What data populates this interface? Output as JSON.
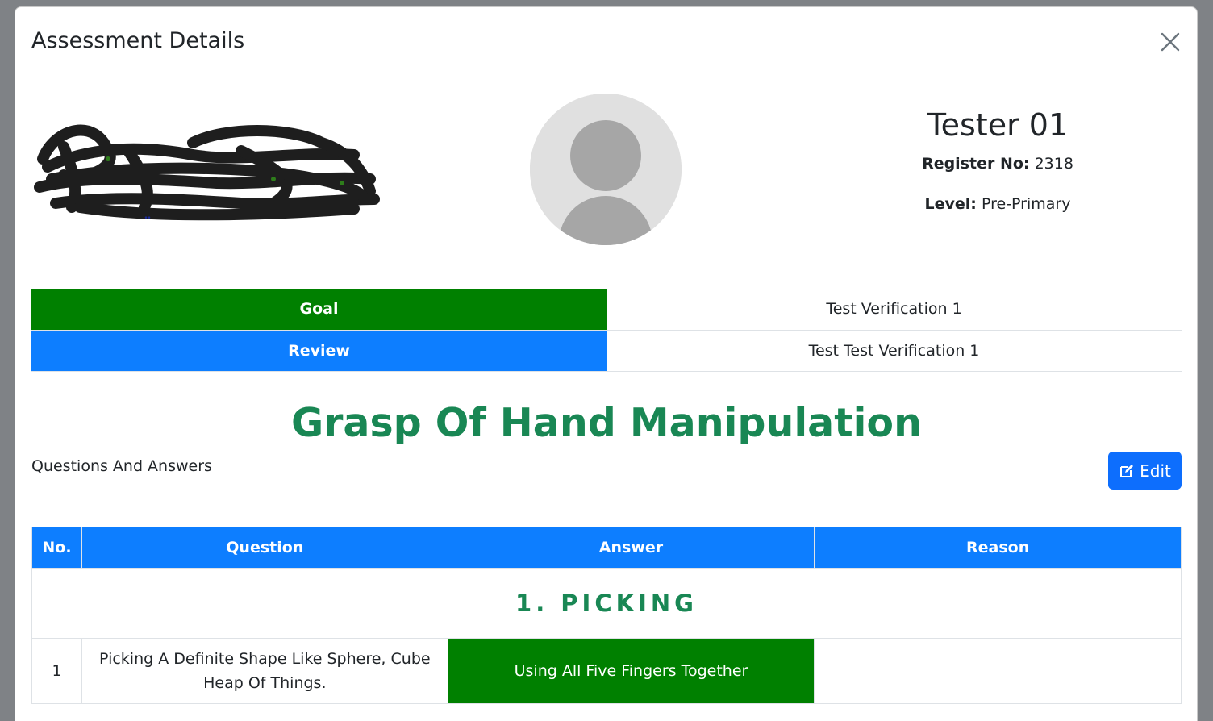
{
  "modal": {
    "title": "Assessment Details"
  },
  "profile": {
    "name": "Tester 01",
    "register_label": "Register No:",
    "register_value": "2318",
    "level_label": "Level:",
    "level_value": "Pre-Primary"
  },
  "goal_review": {
    "goal_label": "Goal",
    "goal_value": "Test Verification 1",
    "review_label": "Review",
    "review_value": "Test Test Verification 1"
  },
  "section": {
    "title": "Grasp Of Hand Manipulation",
    "qa_label": "Questions And Answers",
    "edit_label": "Edit"
  },
  "table": {
    "headers": [
      "No.",
      "Question",
      "Answer",
      "Reason"
    ],
    "category": "1. PICKING",
    "rows": [
      {
        "no": "1",
        "question": "Picking A Definite Shape Like Sphere, Cube Heap Of Things.",
        "answer": "Using All Five Fingers Together",
        "reason": ""
      }
    ]
  },
  "colors": {
    "goal_green": "#008000",
    "review_blue": "#0d7eff",
    "title_green": "#198754",
    "edit_blue": "#0d6efd"
  },
  "icons": {
    "close": "close-icon",
    "edit": "edit-icon",
    "avatar": "user-avatar-icon"
  }
}
